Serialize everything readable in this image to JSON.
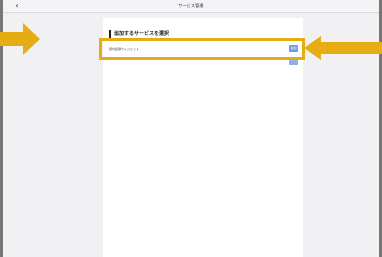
{
  "header": {
    "title": "サービス管理",
    "back_icon": "chevron-left-icon",
    "back_glyph": "‹"
  },
  "main": {
    "section_title": "追加するサービスを選択",
    "service_row": {
      "label": "受付記録ウィジェット",
      "button_label": "追加"
    }
  },
  "overlay": {
    "highlight_color": "#e5ad13",
    "arrow_color": "#e5ad13"
  },
  "colors": {
    "accent": "#6f9be6",
    "background": "#f1f1f4",
    "panel": "#ffffff"
  }
}
